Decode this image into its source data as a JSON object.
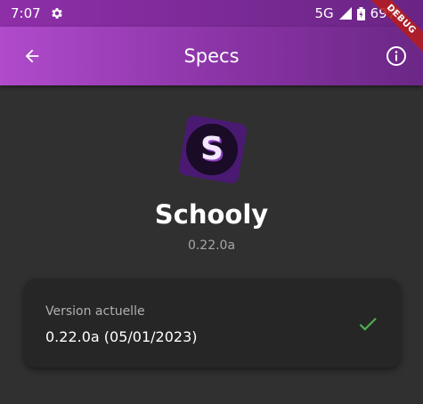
{
  "status_bar": {
    "time": "7:07",
    "network": "5G",
    "battery": "69%"
  },
  "app_bar": {
    "title": "Specs"
  },
  "debug_banner": "DEBUG",
  "app": {
    "logo_letter": "S",
    "name": "Schooly",
    "version": "0.22.0a"
  },
  "version_card": {
    "label": "Version actuelle",
    "value": "0.22.0a (05/01/2023)"
  },
  "colors": {
    "accent_start": "#b04bcc",
    "accent_end": "#6b2785",
    "background": "#303030",
    "card": "#262626",
    "check": "#4caf50",
    "logo_bg": "#4a1a72"
  },
  "icons": {
    "status_gear": "gear-icon",
    "signal": "signal-icon",
    "battery": "battery-icon",
    "back": "arrow-back-icon",
    "info": "info-icon",
    "check": "check-icon"
  }
}
